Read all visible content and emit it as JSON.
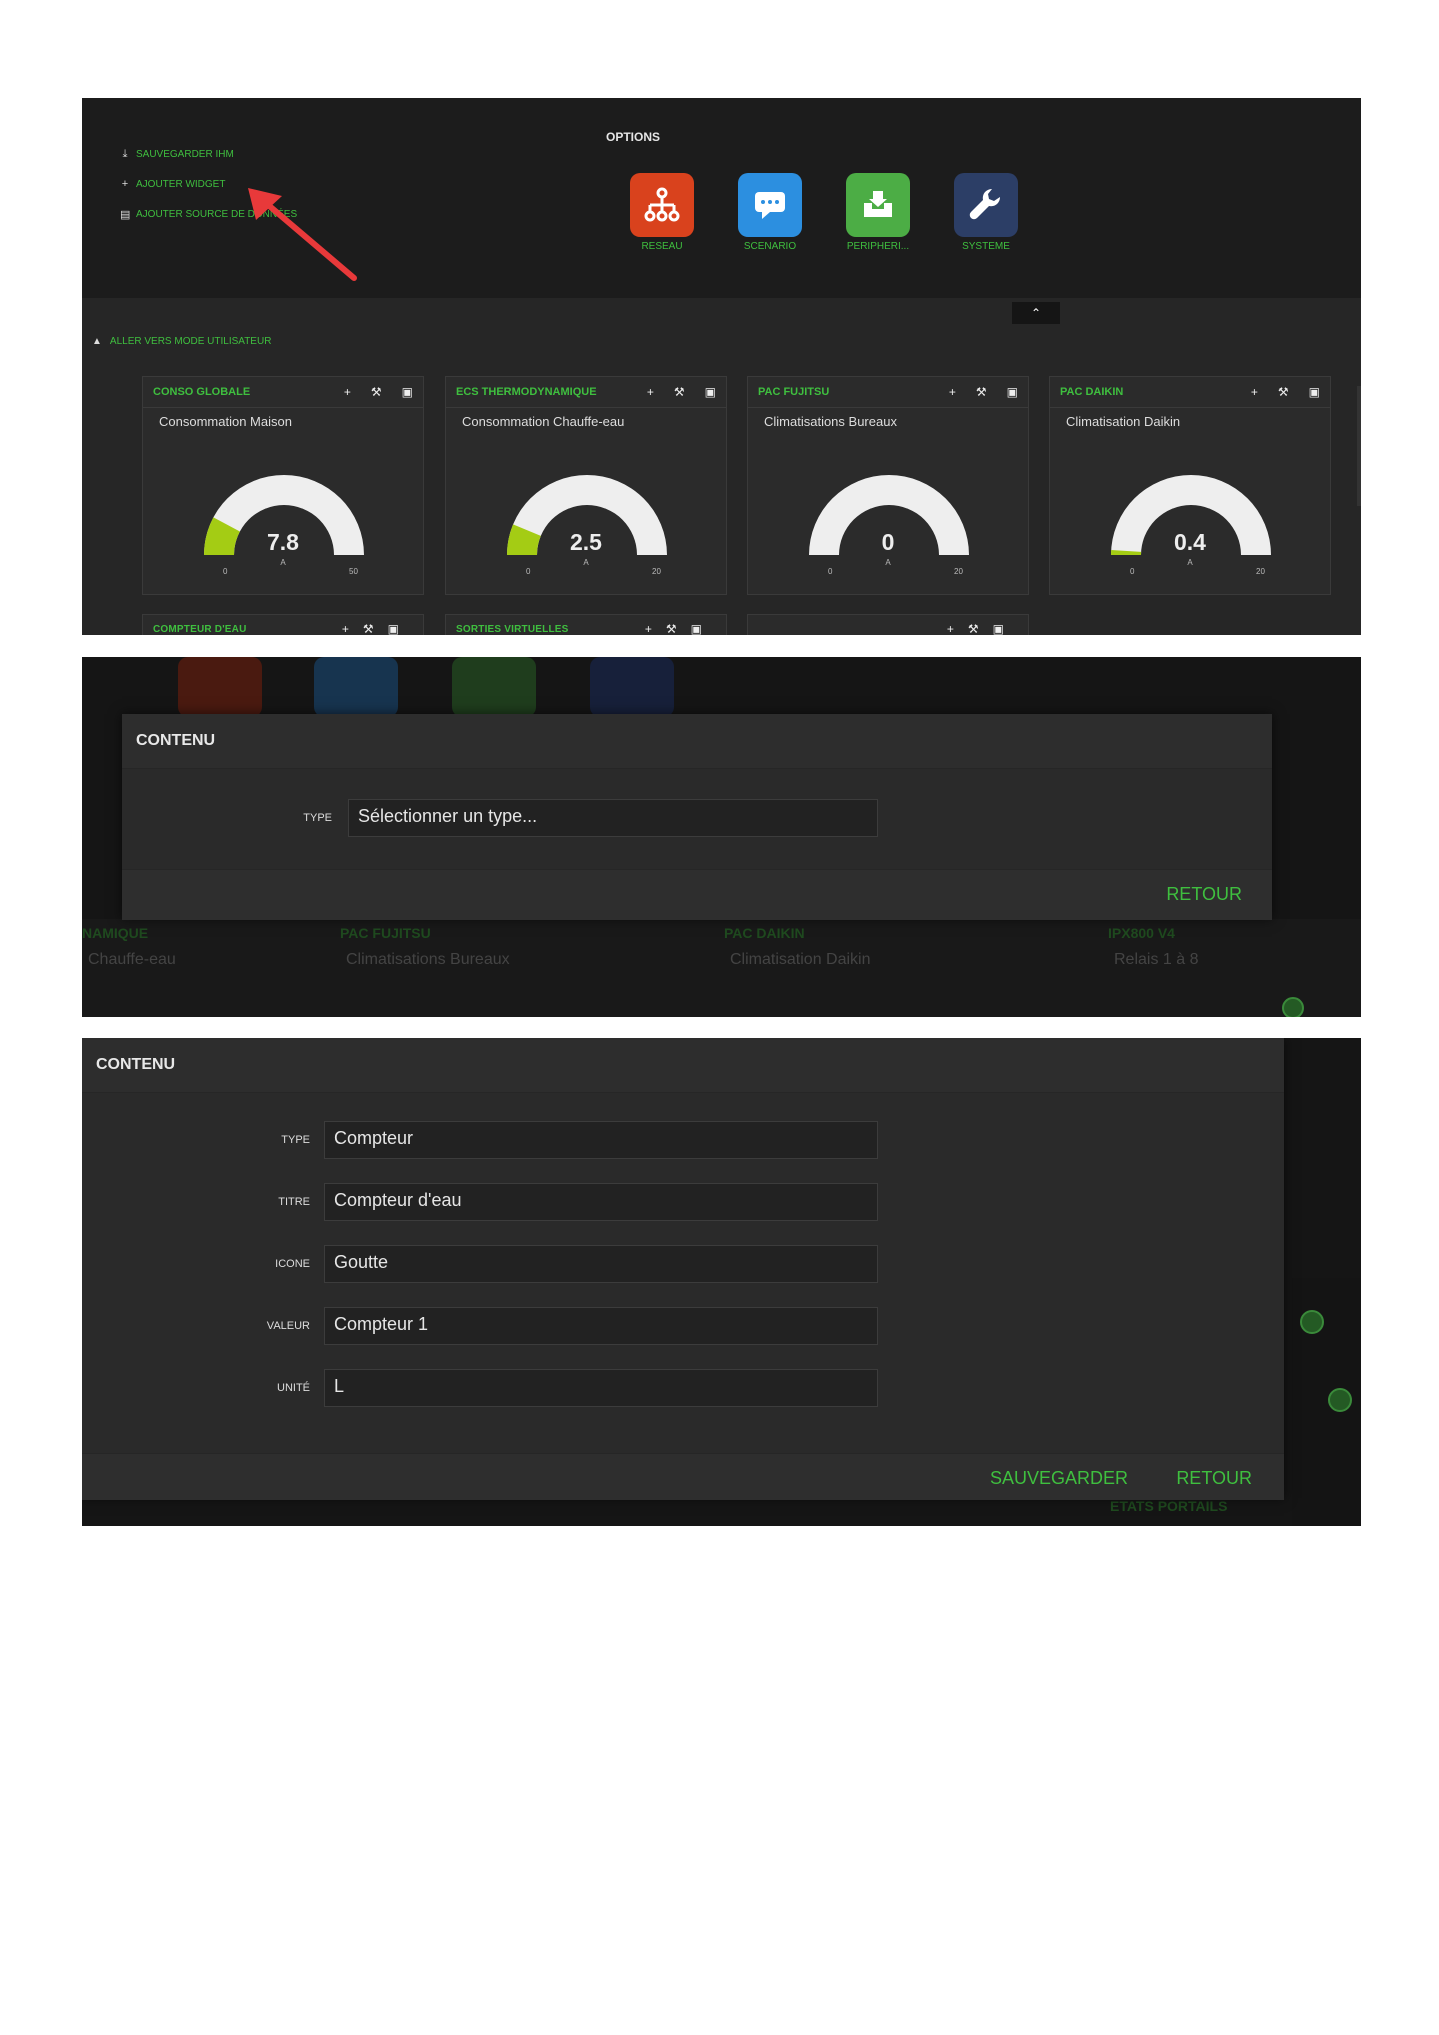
{
  "screenshot1": {
    "toolbar_links": [
      {
        "icon": "download-icon",
        "label": "SAUVEGARDER IHM"
      },
      {
        "icon": "plus-icon",
        "label": "AJOUTER WIDGET"
      },
      {
        "icon": "database-icon",
        "label": "AJOUTER SOURCE DE DONNÉES"
      }
    ],
    "options_title": "OPTIONS",
    "options": [
      {
        "label": "RESEAU",
        "color": "#d9421d",
        "icon": "network-icon"
      },
      {
        "label": "SCENARIO",
        "color": "#2c8fe0",
        "icon": "chat-icon"
      },
      {
        "label": "PERIPHERI...",
        "color": "#4cad45",
        "icon": "inbox-icon"
      },
      {
        "label": "SYSTEME",
        "color": "#2c3e66",
        "icon": "wrench-icon"
      }
    ],
    "collapse_icon": "chevron-up-icon",
    "mode_link": "ALLER VERS MODE UTILISATEUR",
    "widgets": [
      {
        "title": "CONSO GLOBALE",
        "subtitle": "Consommation Maison",
        "value": "7.8",
        "unit": "A",
        "min": "0",
        "max": "50",
        "level": 0.156
      },
      {
        "title": "ECS THERMODYNAMIQUE",
        "subtitle": "Consommation Chauffe-eau",
        "value": "2.5",
        "unit": "A",
        "min": "0",
        "max": "20",
        "level": 0.125
      },
      {
        "title": "PAC FUJITSU",
        "subtitle": "Climatisations Bureaux",
        "value": "0",
        "unit": "A",
        "min": "0",
        "max": "20",
        "level": 0
      },
      {
        "title": "PAC DAIKIN",
        "subtitle": "Climatisation Daikin",
        "value": "0.4",
        "unit": "A",
        "min": "0",
        "max": "20",
        "level": 0.02
      }
    ],
    "widgets_row2": [
      "COMPTEUR D'EAU",
      "SORTIES VIRTUELLES",
      ""
    ],
    "gauge_fill_color": "#a4cc14",
    "accent_color": "#3fbf3f"
  },
  "screenshot2": {
    "dialog_title": "CONTENU",
    "type_label": "TYPE",
    "type_placeholder": "Sélectionner un type...",
    "back_button": "RETOUR",
    "background_labels": [
      "NAMIQUE",
      "Chauffe-eau",
      "PAC FUJITSU",
      "Climatisations Bureaux",
      "PAC DAIKIN",
      "Climatisation Daikin",
      "IPX800 V4",
      "Relais 1 à 8"
    ]
  },
  "screenshot3": {
    "dialog_title": "CONTENU",
    "fields": [
      {
        "label": "TYPE",
        "value": "Compteur"
      },
      {
        "label": "TITRE",
        "value": "Compteur d'eau"
      },
      {
        "label": "ICONE",
        "value": "Goutte"
      },
      {
        "label": "VALEUR",
        "value": "Compteur 1"
      },
      {
        "label": "UNITÉ",
        "value": "L"
      }
    ],
    "save_button": "SAUVEGARDER",
    "back_button": "RETOUR",
    "background_label": "ETATS PORTAILS"
  }
}
